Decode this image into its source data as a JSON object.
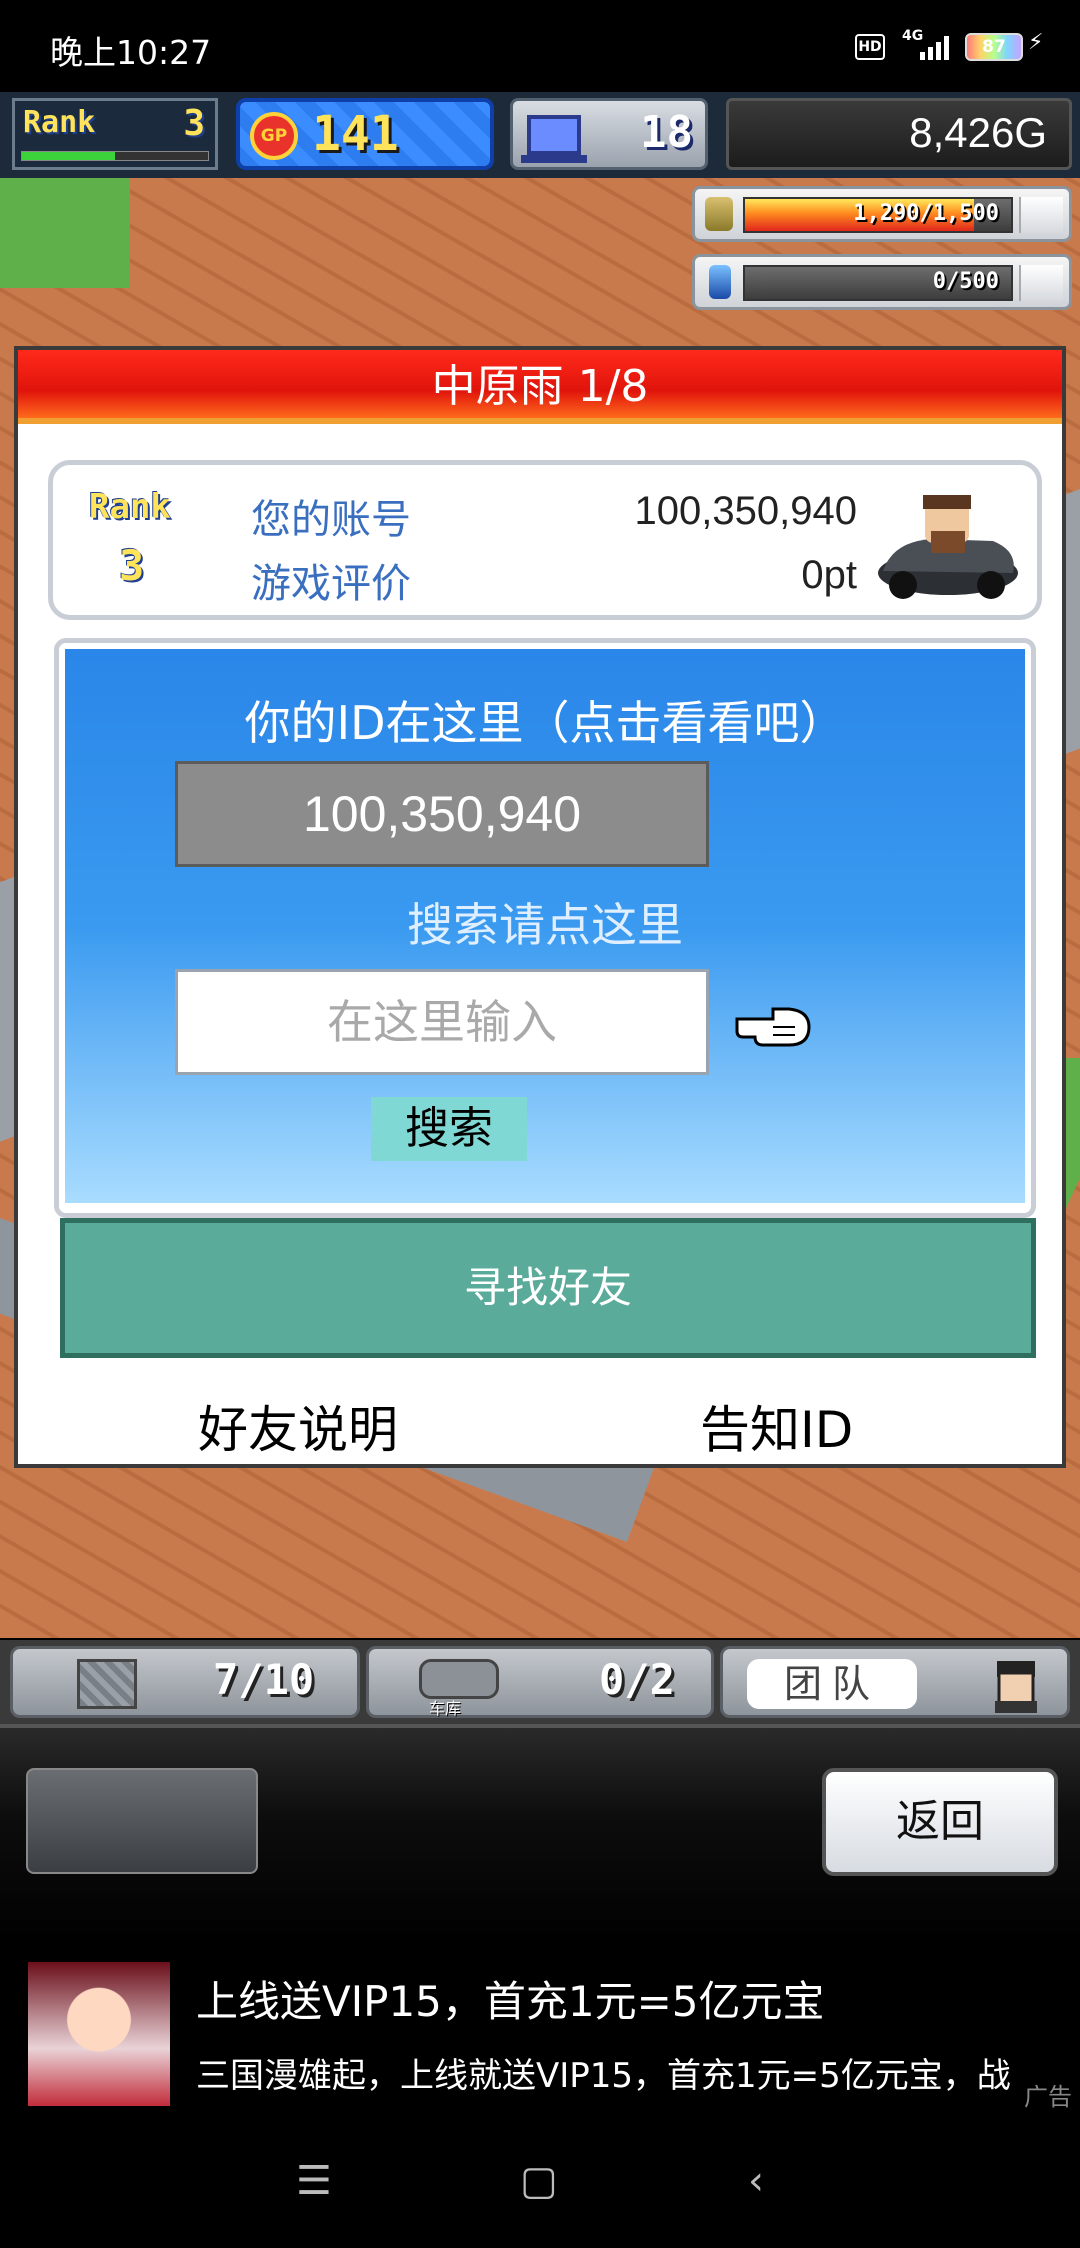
{
  "status_bar": {
    "time": "晚上10:27",
    "hd_badge": "HD",
    "network": "4G",
    "battery": "87"
  },
  "hud": {
    "rank_label": "Rank",
    "rank_value": "3",
    "rank_progress": 0.5,
    "gp_icon_text": "GP",
    "gp_value": "141",
    "computers_value": "18",
    "money": "8,426G"
  },
  "resources": [
    {
      "name": "research-points",
      "text": "1,290/1,500",
      "fill": 0.86
    },
    {
      "name": "fuel",
      "text": "0/500",
      "fill": 0.0
    }
  ],
  "dialog": {
    "title": "中原雨 1/8",
    "account": {
      "rank_label": "Rank",
      "rank_value": "3",
      "id_label": "您的账号",
      "id_value": "100,350,940",
      "rating_label": "游戏评价",
      "rating_value": "0pt"
    },
    "search": {
      "header": "你的ID在这里（点击看看吧）",
      "id_display": "100,350,940",
      "search_hint": "搜索请点这里",
      "input_placeholder": "在这里输入",
      "search_button": "搜索"
    },
    "find_friends_button": "寻找好友",
    "friend_help_link": "好友说明",
    "tell_id_link": "告知ID"
  },
  "tray": {
    "storage_count": "7/10",
    "garage_count": "0/2",
    "garage_label": "车库",
    "team_label": "团队"
  },
  "bottom": {
    "back_button": "返回"
  },
  "ad": {
    "title": "上线送VIP15，首充1元=5亿元宝",
    "body": "三国漫雄起，上线就送VIP15，首充1元=5亿元宝，战",
    "mark": "广告"
  },
  "colors": {
    "title_red": "#e0140c",
    "panel_blue": "#2a86e8",
    "find_teal": "#5aab9a",
    "search_button": "#7fd8d4"
  }
}
